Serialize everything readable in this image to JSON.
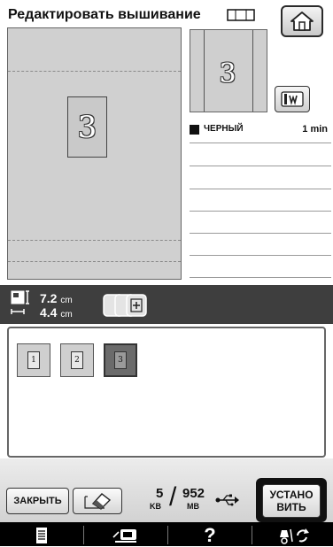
{
  "header": {
    "title": "Редактировать вышивание",
    "hoop_icon": "hoop-size-icon",
    "home_icon": "home-icon"
  },
  "preview": {
    "pattern_glyph": "3",
    "thumbnail_glyph": "3",
    "frame_button_icon": "embroidery-frame-icon"
  },
  "color_list": {
    "items": [
      {
        "name": "ЧЕРНЫЙ",
        "time": "1 min",
        "color": "#111111"
      }
    ]
  },
  "size": {
    "width": "7.2",
    "height": "4.4",
    "unit": "cm"
  },
  "selection": {
    "items": [
      {
        "glyph": "1"
      },
      {
        "glyph": "2"
      },
      {
        "glyph": "3",
        "selected": true
      }
    ]
  },
  "toolbar": {
    "close_label": "ЗАКРЫТЬ",
    "eraser_icon": "eraser-icon",
    "memory_used": "5",
    "memory_used_unit": "KB",
    "memory_total": "952",
    "memory_total_unit": "MB",
    "usb_icon": "usb-icon",
    "set_label_line1": "УСТАНО",
    "set_label_line2": "ВИТЬ"
  },
  "tabs": {
    "items": [
      {
        "icon": "document-icon"
      },
      {
        "icon": "sewing-machine-icon"
      },
      {
        "label": "?"
      },
      {
        "icon": "settings-icon"
      }
    ]
  },
  "colors": {
    "screen_bg": "#d0d0d0",
    "dark_bar": "#3e3e3e",
    "selected_item": "#6b6b6b"
  }
}
